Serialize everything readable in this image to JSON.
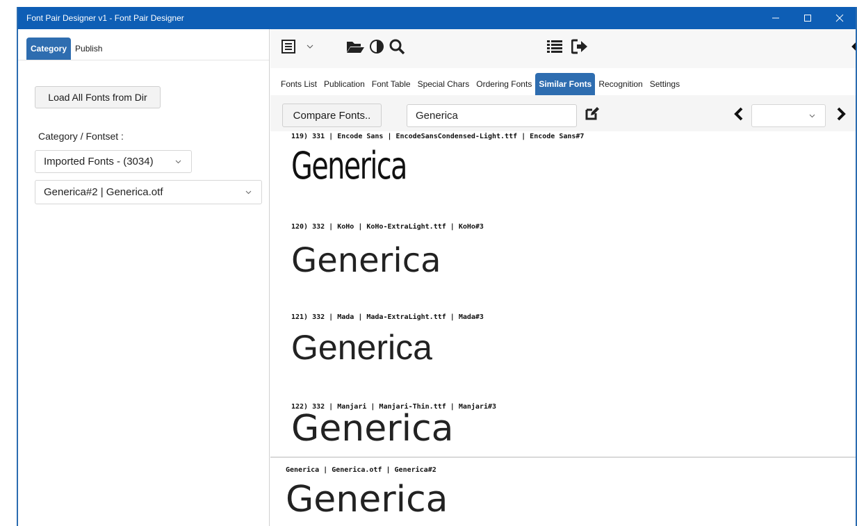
{
  "window": {
    "title": "Font Pair Designer v1 - Font Pair Designer",
    "controls": [
      "minimize",
      "maximize",
      "close"
    ]
  },
  "left": {
    "tabs": [
      {
        "label": "Category",
        "active": true
      },
      {
        "label": "Publish",
        "active": false
      }
    ],
    "load_button": "Load All Fonts from Dir",
    "category_label": "Category / Fontset :",
    "category_select": "Imported Fonts - (3034)",
    "font_select": "Generica#2 | Generica.otf"
  },
  "toolbar": {
    "icons": [
      "list-view-icon",
      "chevron-down-icon",
      "folder-open-icon",
      "adjust-icon",
      "search-icon",
      "list-icon",
      "sign-out-icon",
      "chevron-left-icon"
    ]
  },
  "tabs": [
    {
      "label": "Fonts List",
      "active": false
    },
    {
      "label": "Publication",
      "active": false
    },
    {
      "label": "Font Table",
      "active": false
    },
    {
      "label": "Special Chars",
      "active": false
    },
    {
      "label": "Ordering Fonts",
      "active": false
    },
    {
      "label": "Similar Fonts",
      "active": true
    },
    {
      "label": "Recognition",
      "active": false
    },
    {
      "label": "Settings",
      "active": false
    }
  ],
  "compare": {
    "button": "Compare Fonts..",
    "sample_text": "Generica",
    "page_select": ""
  },
  "results": [
    {
      "header": "119) 331 | Encode Sans | EncodeSansCondensed-Light.ttf | Encode Sans#7",
      "sample": "Generica"
    },
    {
      "header": "120) 332 | KoHo | KoHo-ExtraLight.ttf | KoHo#3",
      "sample": "Generica"
    },
    {
      "header": "121) 332 | Mada | Mada-ExtraLight.ttf | Mada#3",
      "sample": "Generica"
    },
    {
      "header": "122) 332 | Manjari | Manjari-Thin.ttf | Manjari#3",
      "sample": "Generica"
    }
  ],
  "reference": {
    "header": "Generica | Generica.otf | Generica#2",
    "sample": "Generica"
  },
  "colors": {
    "titlebar": "#0e5eb5",
    "active_tab": "#2e6db0"
  }
}
